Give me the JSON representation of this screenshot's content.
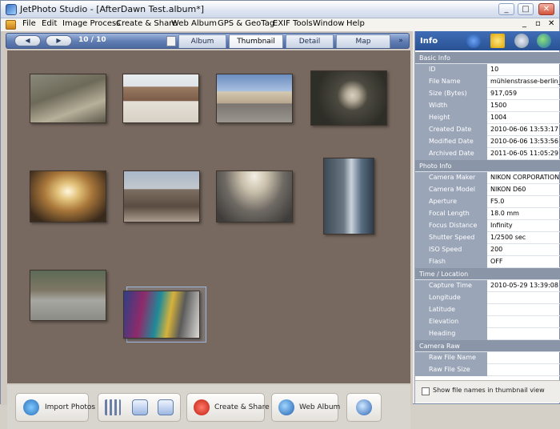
{
  "window": {
    "title": "JetPhoto Studio - [AfterDawn Test.album*]",
    "min": "_",
    "max": "□",
    "close": "✕"
  },
  "menu": {
    "items": [
      "File",
      "Edit",
      "Image Process",
      "Create & Share",
      "Web Album",
      "GPS & GeoTag",
      "EXIF Tools",
      "Window",
      "Help"
    ],
    "mdi_min": "_",
    "mdi_restore": "▫",
    "mdi_close": "✕"
  },
  "nav": {
    "back": "◀",
    "forward": "▶",
    "counter": "10 / 10",
    "tabs": [
      "Album",
      "Thumbnail",
      "Detail",
      "Map"
    ],
    "active_tab": "Thumbnail",
    "more": "»"
  },
  "thumbnails": [
    {
      "name": "aerial-city"
    },
    {
      "name": "square-buildings"
    },
    {
      "name": "street-view"
    },
    {
      "name": "bird-on-pipe"
    },
    {
      "name": "tunnel-light"
    },
    {
      "name": "city-crowd"
    },
    {
      "name": "dome-roof"
    },
    {
      "name": "tall-tower"
    },
    {
      "name": "street-cyclist"
    },
    {
      "name": "graffiti-wall"
    }
  ],
  "selected_thumbnail": "graffiti-wall",
  "bottom": {
    "import": "Import Photos",
    "create_share": "Create & Share",
    "web_album": "Web Album"
  },
  "info": {
    "title": "Info",
    "groups": [
      {
        "name": "Basic Info",
        "rows": [
          {
            "k": "ID",
            "v": "10"
          },
          {
            "k": "File Name",
            "v": "mühlenstrasse-berlin_"
          },
          {
            "k": "Size (Bytes)",
            "v": "917,059"
          },
          {
            "k": "Width",
            "v": "1500"
          },
          {
            "k": "Height",
            "v": "1004"
          },
          {
            "k": "Created Date",
            "v": "2010-06-06 13:53:17"
          },
          {
            "k": "Modified Date",
            "v": "2010-06-06 13:53:56"
          },
          {
            "k": "Archived Date",
            "v": "2011-06-05 11:05:29"
          }
        ]
      },
      {
        "name": "Photo Info",
        "rows": [
          {
            "k": "Camera Maker",
            "v": "NIKON CORPORATION"
          },
          {
            "k": "Camera Model",
            "v": "NIKON D60"
          },
          {
            "k": "Aperture",
            "v": "F5.0"
          },
          {
            "k": "Focal Length",
            "v": "18.0 mm"
          },
          {
            "k": "Focus Distance",
            "v": "Infinity"
          },
          {
            "k": "Shutter Speed",
            "v": "1/2500 sec"
          },
          {
            "k": "ISO Speed",
            "v": "200"
          },
          {
            "k": "Flash",
            "v": "OFF"
          }
        ]
      },
      {
        "name": "Time / Location",
        "rows": [
          {
            "k": "Capture Time",
            "v": "2010-05-29 13:39:08"
          },
          {
            "k": "Longitude",
            "v": ""
          },
          {
            "k": "Latitude",
            "v": ""
          },
          {
            "k": "Elevation",
            "v": ""
          },
          {
            "k": "Heading",
            "v": ""
          }
        ]
      },
      {
        "name": "Camera Raw",
        "rows": [
          {
            "k": "Raw File Name",
            "v": ""
          },
          {
            "k": "Raw File Size",
            "v": ""
          }
        ]
      }
    ],
    "checkbox_label": "Show file names in thumbnail view",
    "checkbox_checked": false
  }
}
